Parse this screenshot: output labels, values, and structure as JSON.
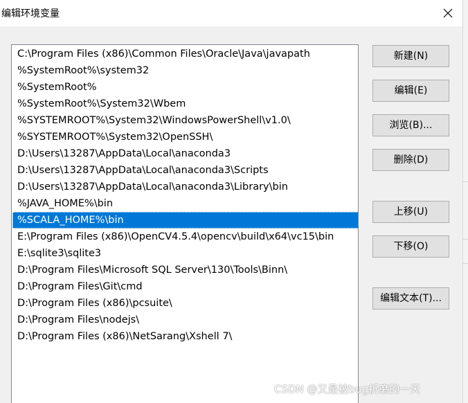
{
  "window": {
    "title": "编辑环境变量"
  },
  "paths": {
    "items": [
      "C:\\Program Files (x86)\\Common Files\\Oracle\\Java\\javapath",
      "%SystemRoot%\\system32",
      "%SystemRoot%",
      "%SystemRoot%\\System32\\Wbem",
      "%SYSTEMROOT%\\System32\\WindowsPowerShell\\v1.0\\",
      "%SYSTEMROOT%\\System32\\OpenSSH\\",
      "D:\\Users\\13287\\AppData\\Local\\anaconda3",
      "D:\\Users\\13287\\AppData\\Local\\anaconda3\\Scripts",
      "D:\\Users\\13287\\AppData\\Local\\anaconda3\\Library\\bin",
      "%JAVA_HOME%\\bin",
      "%SCALA_HOME%\\bin",
      "E:\\Program Files (x86)\\OpenCV4.5.4\\opencv\\build\\x64\\vc15\\bin",
      "E:\\sqlite3\\sqlite3",
      "D:\\Program Files\\Microsoft SQL Server\\130\\Tools\\Binn\\",
      "D:\\Program Files\\Git\\cmd",
      "D:\\Program Files (x86)\\pcsuite\\",
      "D:\\Program Files\\nodejs\\",
      "D:\\Program Files (x86)\\NetSarang\\Xshell 7\\"
    ],
    "selected_index": 10
  },
  "buttons": {
    "new": "新建(N)",
    "edit": "编辑(E)",
    "browse": "浏览(B)...",
    "delete": "删除(D)",
    "move_up": "上移(U)",
    "move_down": "下移(O)",
    "edit_text": "编辑文本(T)..."
  },
  "watermark": "CSDN @又是被bug折磨的一天",
  "colors": {
    "selection": "#0078d7",
    "button_face": "#e1e1e1",
    "dialog_background": "#f0f0f0"
  }
}
